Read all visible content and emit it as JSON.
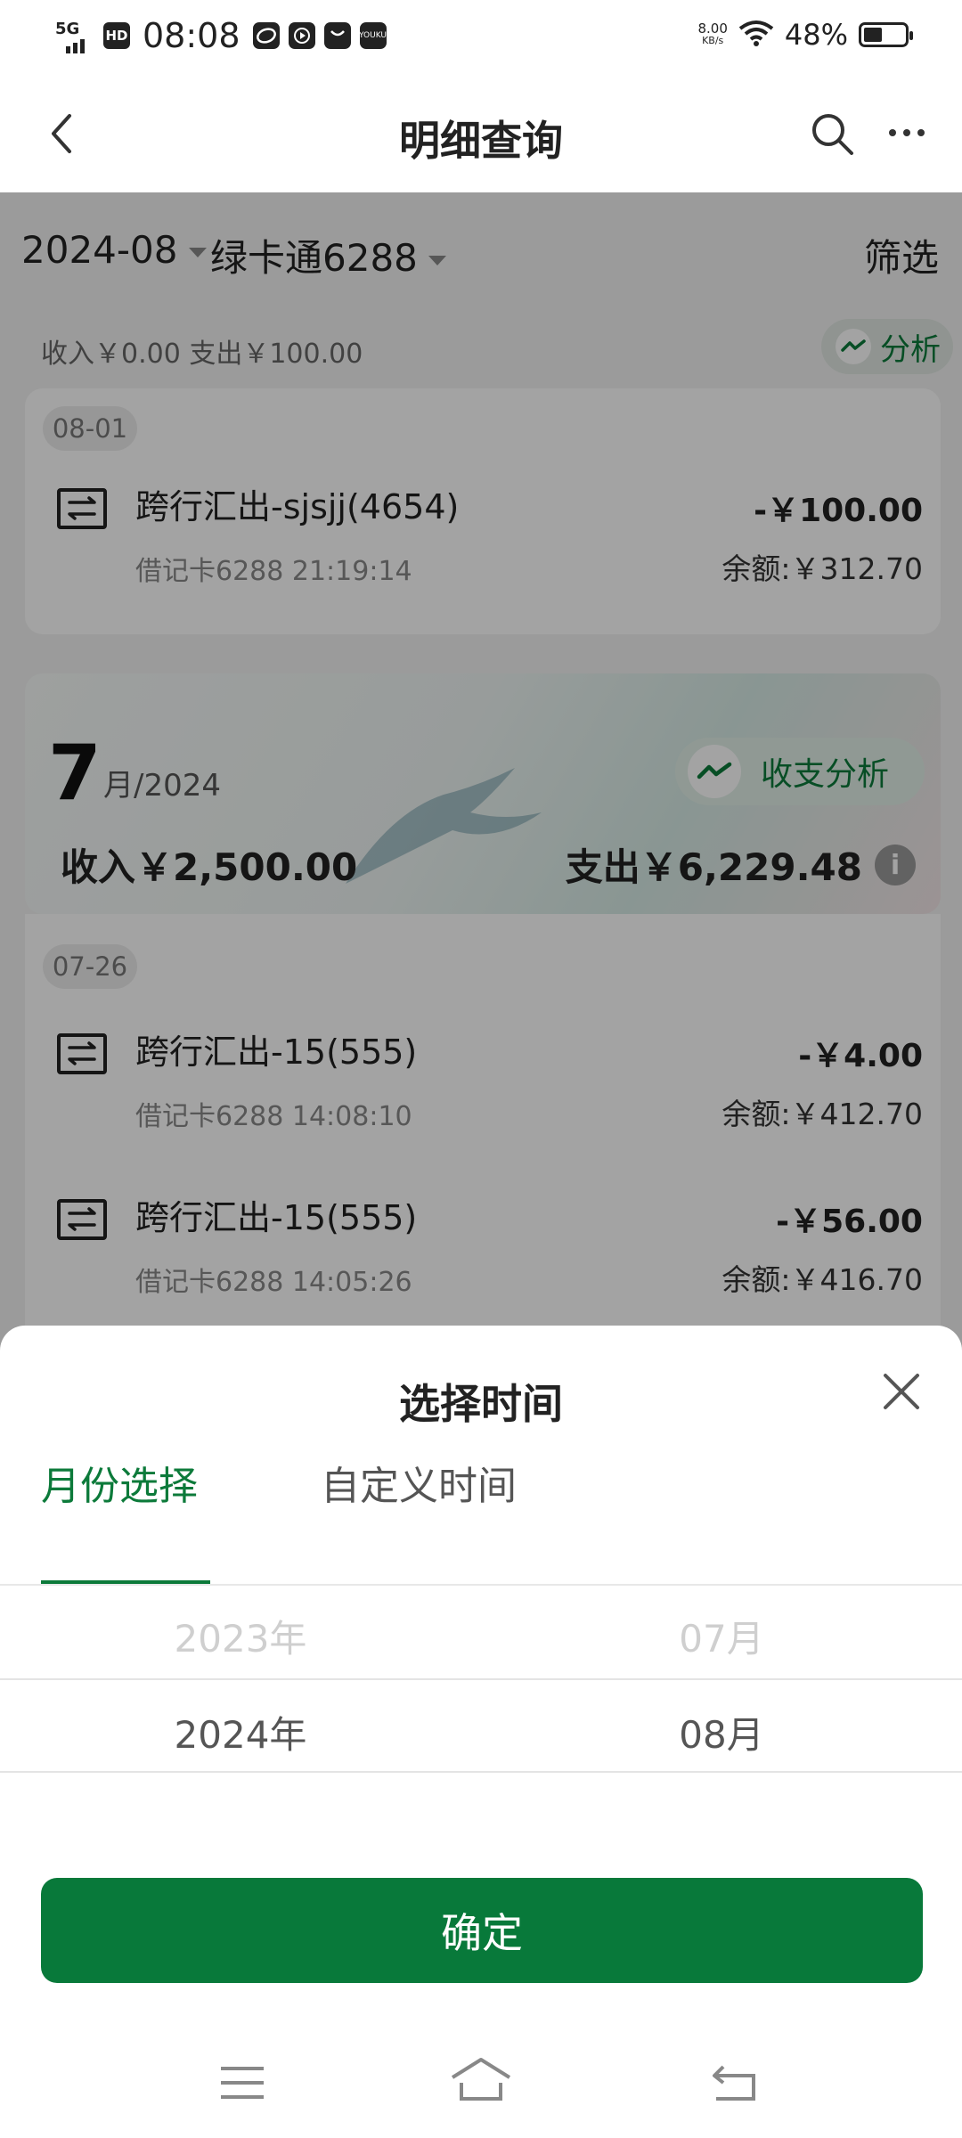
{
  "status_bar": {
    "network": "5G",
    "hd": "HD",
    "time": "08:08",
    "app_icon_label": "YOUKU",
    "speed_value": "8.00",
    "speed_unit": "KB/s",
    "battery": "48%"
  },
  "header": {
    "title": "明细查询"
  },
  "filters": {
    "month": "2024-08",
    "card": "绿卡通6288",
    "filter_label": "筛选"
  },
  "summary": {
    "text": "收入￥0.00 支出￥100.00",
    "analyze_label": "分析"
  },
  "aug_card": {
    "date": "08-01",
    "transactions": [
      {
        "name": "跨行汇出-sjsjj(4654)",
        "amount": "-￥100.00",
        "sub": "借记卡6288  21:19:14",
        "balance": "余额:￥312.70"
      }
    ]
  },
  "month_banner": {
    "month_number": "7",
    "month_year": "月/2024",
    "analyze_label": "收支分析",
    "income": "收入￥2,500.00",
    "expense": "支出￥6,229.48",
    "info_icon": "i"
  },
  "jul_card": {
    "date": "07-26",
    "transactions": [
      {
        "name": "跨行汇出-15(555)",
        "amount": "-￥4.00",
        "sub": "借记卡6288  14:08:10",
        "balance": "余额:￥412.70"
      },
      {
        "name": "跨行汇出-15(555)",
        "amount": "-￥56.00",
        "sub": "借记卡6288  14:05:26",
        "balance": "余额:￥416.70"
      }
    ]
  },
  "sheet": {
    "title": "选择时间",
    "tabs": [
      {
        "label": "月份选择",
        "active": true
      },
      {
        "label": "自定义时间",
        "active": false
      }
    ],
    "picker": {
      "prev_year": "2023年",
      "prev_month": "07月",
      "selected_year": "2024年",
      "selected_month": "08月"
    },
    "confirm_label": "确定"
  },
  "colors": {
    "accent": "#08793a",
    "overlay": "rgba(0,0,0,0.36)"
  }
}
